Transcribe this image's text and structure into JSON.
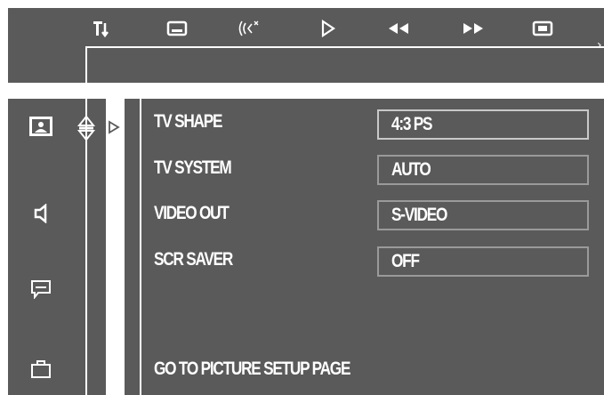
{
  "toolbar": {
    "icons": [
      {
        "name": "system-setup-icon",
        "glyph": "T⇣"
      },
      {
        "name": "picture-setup-icon",
        "glyph": "▭"
      },
      {
        "name": "audio-setup-icon",
        "glyph": "((‹"
      },
      {
        "name": "play-icon",
        "glyph": "▷"
      },
      {
        "name": "rewind-icon",
        "glyph": "◀◀"
      },
      {
        "name": "fast-forward-icon",
        "glyph": "▶▶"
      },
      {
        "name": "display-icon",
        "glyph": "▣"
      }
    ],
    "edge_glyph": "›"
  },
  "sidebar": {
    "items": [
      {
        "name": "picture-icon",
        "selected": true
      },
      {
        "name": "speaker-icon",
        "selected": false
      },
      {
        "name": "language-icon",
        "selected": false
      },
      {
        "name": "preference-icon",
        "selected": false
      }
    ]
  },
  "settings": {
    "rows": [
      {
        "label": "TV SHAPE",
        "value": "4:3 PS"
      },
      {
        "label": "TV SYSTEM",
        "value": "AUTO"
      },
      {
        "label": "VIDEO OUT",
        "value": "S-VIDEO"
      },
      {
        "label": "SCR SAVER",
        "value": "OFF"
      }
    ],
    "selected_index": 0
  },
  "footer": {
    "hint": "GO TO PICTURE SETUP PAGE"
  },
  "colors": {
    "background": "#5a5a5a",
    "text": "#ffffff",
    "border": "#9a9a9a"
  }
}
